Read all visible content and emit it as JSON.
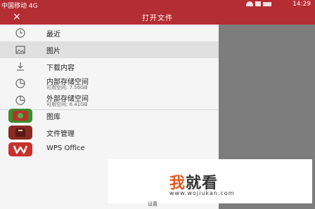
{
  "status_bar": {
    "carrier": "中国移动 4G",
    "time": "14:29",
    "icons": [
      "wechat-icon",
      "notification-icon",
      "wifi-icon",
      "signal-icon",
      "battery-icon"
    ]
  },
  "app_bar": {
    "close_icon": "×",
    "title": "打开文件"
  },
  "drawer": {
    "items": [
      {
        "label": "最近",
        "icon": "clock-icon",
        "selected": false
      },
      {
        "label": "图片",
        "icon": "image-icon",
        "selected": true
      },
      {
        "label": "下载内容",
        "icon": "download-icon",
        "selected": false
      }
    ],
    "storage": [
      {
        "label": "内部存储空间",
        "sub": "可用空间: 7.56GB",
        "icon": "pie-storage-icon"
      },
      {
        "label": "外部存储空间",
        "sub": "可用空间: 6.41GB",
        "icon": "pie-storage-icon"
      }
    ],
    "apps": [
      {
        "label": "图库",
        "icon": "gallery-app-icon",
        "color": "#3d8c2a"
      },
      {
        "label": "文件管理",
        "icon": "file-manager-app-icon",
        "color": "#8a2a22"
      },
      {
        "label": "WPS Office",
        "icon": "wps-office-app-icon",
        "color": "#c9302c"
      }
    ]
  },
  "watermark": {
    "title_part1": "我",
    "title_part2": "就看",
    "url": "www.wojiukan.com"
  },
  "bottom_partial_label": "设置",
  "colors": {
    "app_bar": "#b42d33",
    "drawer_bg": "#f5f5f5",
    "selected_bg": "#e0e0e0",
    "scrim": "#7d7d7d",
    "wm_accent": "#e05a1e"
  }
}
